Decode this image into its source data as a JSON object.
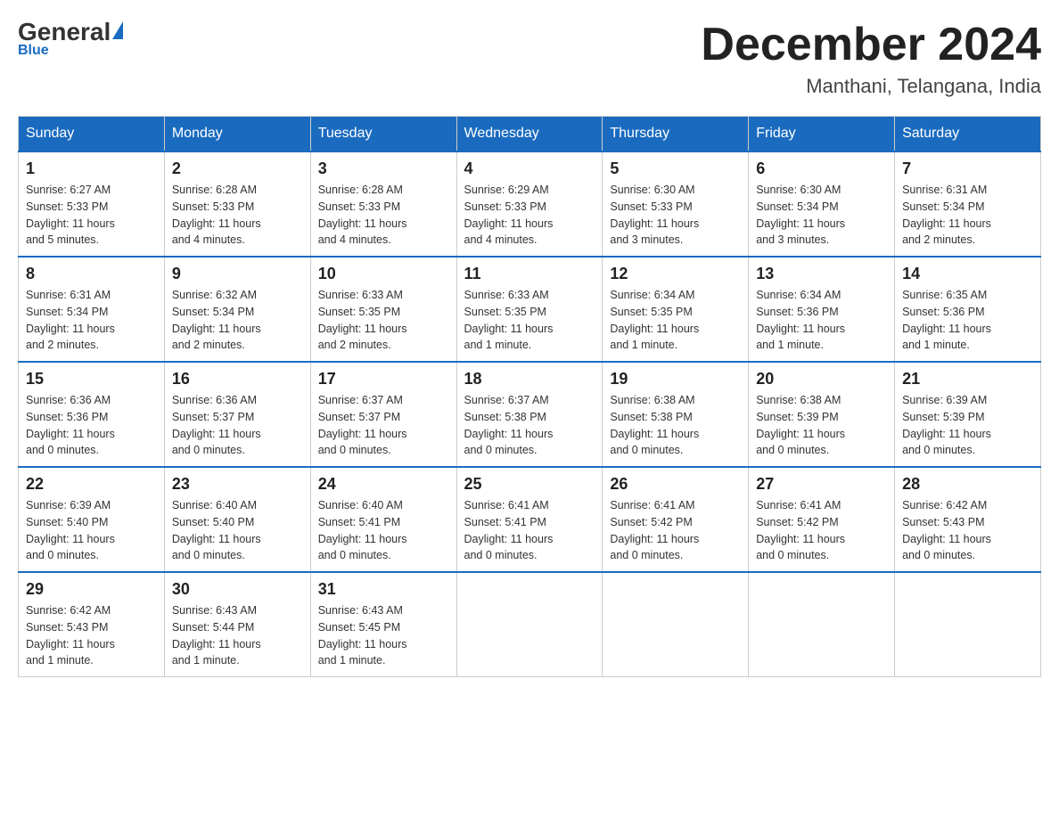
{
  "header": {
    "logo": {
      "general": "General",
      "blue": "Blue",
      "underline": "Blue"
    },
    "title": "December 2024",
    "location": "Manthani, Telangana, India"
  },
  "weekdays": [
    "Sunday",
    "Monday",
    "Tuesday",
    "Wednesday",
    "Thursday",
    "Friday",
    "Saturday"
  ],
  "weeks": [
    [
      {
        "day": "1",
        "sunrise": "6:27 AM",
        "sunset": "5:33 PM",
        "daylight": "11 hours and 5 minutes."
      },
      {
        "day": "2",
        "sunrise": "6:28 AM",
        "sunset": "5:33 PM",
        "daylight": "11 hours and 4 minutes."
      },
      {
        "day": "3",
        "sunrise": "6:28 AM",
        "sunset": "5:33 PM",
        "daylight": "11 hours and 4 minutes."
      },
      {
        "day": "4",
        "sunrise": "6:29 AM",
        "sunset": "5:33 PM",
        "daylight": "11 hours and 4 minutes."
      },
      {
        "day": "5",
        "sunrise": "6:30 AM",
        "sunset": "5:33 PM",
        "daylight": "11 hours and 3 minutes."
      },
      {
        "day": "6",
        "sunrise": "6:30 AM",
        "sunset": "5:34 PM",
        "daylight": "11 hours and 3 minutes."
      },
      {
        "day": "7",
        "sunrise": "6:31 AM",
        "sunset": "5:34 PM",
        "daylight": "11 hours and 2 minutes."
      }
    ],
    [
      {
        "day": "8",
        "sunrise": "6:31 AM",
        "sunset": "5:34 PM",
        "daylight": "11 hours and 2 minutes."
      },
      {
        "day": "9",
        "sunrise": "6:32 AM",
        "sunset": "5:34 PM",
        "daylight": "11 hours and 2 minutes."
      },
      {
        "day": "10",
        "sunrise": "6:33 AM",
        "sunset": "5:35 PM",
        "daylight": "11 hours and 2 minutes."
      },
      {
        "day": "11",
        "sunrise": "6:33 AM",
        "sunset": "5:35 PM",
        "daylight": "11 hours and 1 minute."
      },
      {
        "day": "12",
        "sunrise": "6:34 AM",
        "sunset": "5:35 PM",
        "daylight": "11 hours and 1 minute."
      },
      {
        "day": "13",
        "sunrise": "6:34 AM",
        "sunset": "5:36 PM",
        "daylight": "11 hours and 1 minute."
      },
      {
        "day": "14",
        "sunrise": "6:35 AM",
        "sunset": "5:36 PM",
        "daylight": "11 hours and 1 minute."
      }
    ],
    [
      {
        "day": "15",
        "sunrise": "6:36 AM",
        "sunset": "5:36 PM",
        "daylight": "11 hours and 0 minutes."
      },
      {
        "day": "16",
        "sunrise": "6:36 AM",
        "sunset": "5:37 PM",
        "daylight": "11 hours and 0 minutes."
      },
      {
        "day": "17",
        "sunrise": "6:37 AM",
        "sunset": "5:37 PM",
        "daylight": "11 hours and 0 minutes."
      },
      {
        "day": "18",
        "sunrise": "6:37 AM",
        "sunset": "5:38 PM",
        "daylight": "11 hours and 0 minutes."
      },
      {
        "day": "19",
        "sunrise": "6:38 AM",
        "sunset": "5:38 PM",
        "daylight": "11 hours and 0 minutes."
      },
      {
        "day": "20",
        "sunrise": "6:38 AM",
        "sunset": "5:39 PM",
        "daylight": "11 hours and 0 minutes."
      },
      {
        "day": "21",
        "sunrise": "6:39 AM",
        "sunset": "5:39 PM",
        "daylight": "11 hours and 0 minutes."
      }
    ],
    [
      {
        "day": "22",
        "sunrise": "6:39 AM",
        "sunset": "5:40 PM",
        "daylight": "11 hours and 0 minutes."
      },
      {
        "day": "23",
        "sunrise": "6:40 AM",
        "sunset": "5:40 PM",
        "daylight": "11 hours and 0 minutes."
      },
      {
        "day": "24",
        "sunrise": "6:40 AM",
        "sunset": "5:41 PM",
        "daylight": "11 hours and 0 minutes."
      },
      {
        "day": "25",
        "sunrise": "6:41 AM",
        "sunset": "5:41 PM",
        "daylight": "11 hours and 0 minutes."
      },
      {
        "day": "26",
        "sunrise": "6:41 AM",
        "sunset": "5:42 PM",
        "daylight": "11 hours and 0 minutes."
      },
      {
        "day": "27",
        "sunrise": "6:41 AM",
        "sunset": "5:42 PM",
        "daylight": "11 hours and 0 minutes."
      },
      {
        "day": "28",
        "sunrise": "6:42 AM",
        "sunset": "5:43 PM",
        "daylight": "11 hours and 0 minutes."
      }
    ],
    [
      {
        "day": "29",
        "sunrise": "6:42 AM",
        "sunset": "5:43 PM",
        "daylight": "11 hours and 1 minute."
      },
      {
        "day": "30",
        "sunrise": "6:43 AM",
        "sunset": "5:44 PM",
        "daylight": "11 hours and 1 minute."
      },
      {
        "day": "31",
        "sunrise": "6:43 AM",
        "sunset": "5:45 PM",
        "daylight": "11 hours and 1 minute."
      },
      null,
      null,
      null,
      null
    ]
  ],
  "labels": {
    "sunrise": "Sunrise:",
    "sunset": "Sunset:",
    "daylight": "Daylight:"
  }
}
